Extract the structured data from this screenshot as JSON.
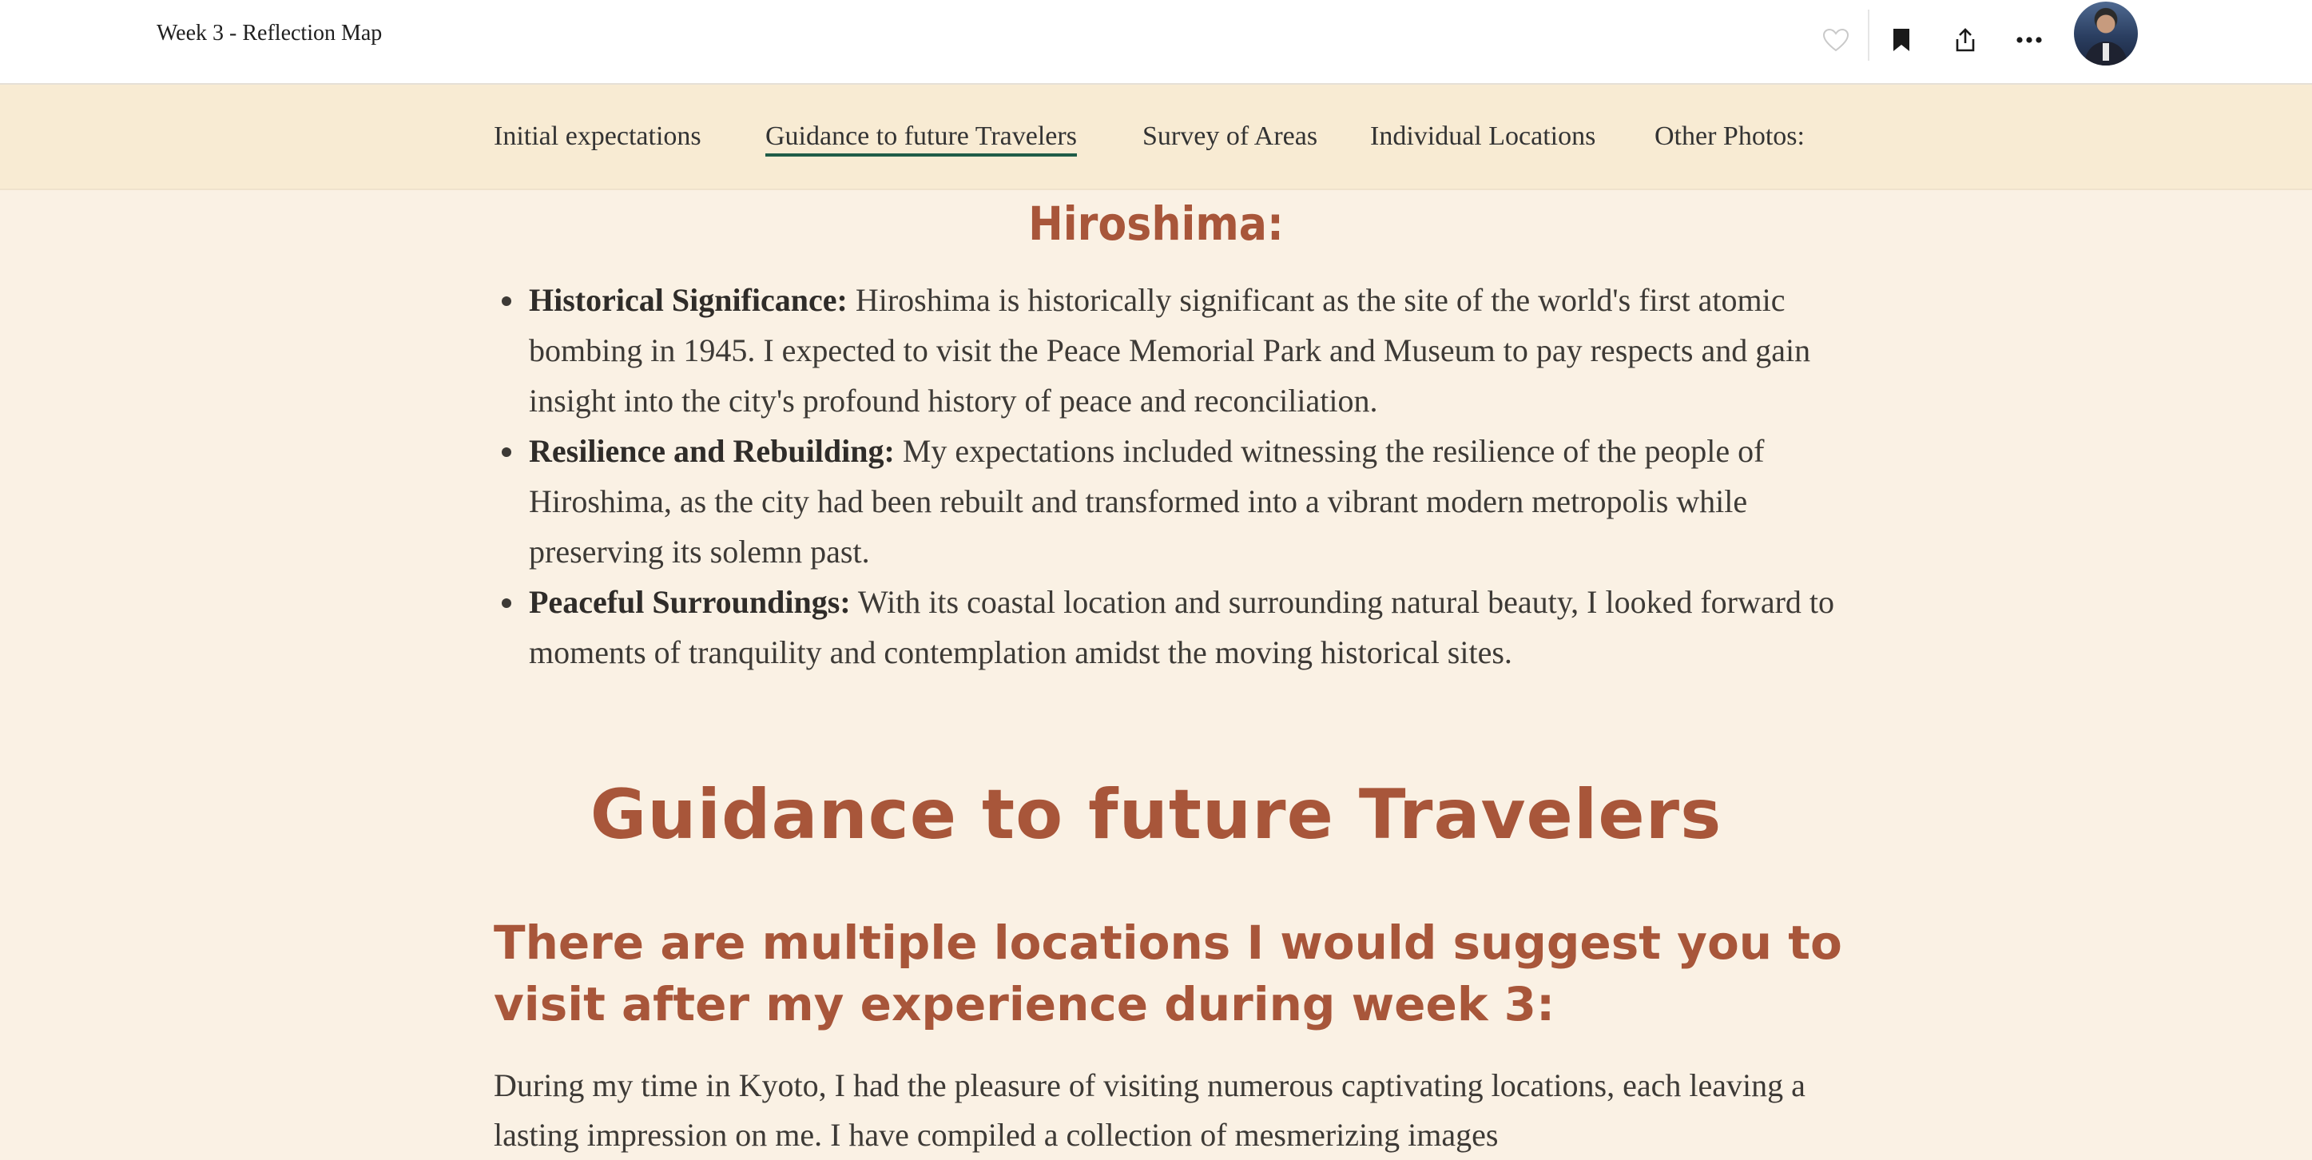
{
  "header": {
    "title": "Week 3 - Reflection Map",
    "actions": {
      "heart": "heart-icon",
      "bookmark": "bookmark-icon",
      "share": "share-icon",
      "more": "more-icon"
    }
  },
  "nav": {
    "items": [
      {
        "label": "Initial expectations"
      },
      {
        "label": "Guidance to future Travelers"
      },
      {
        "label": "Survey of Areas"
      },
      {
        "label": "Individual Locations"
      },
      {
        "label": "Other Photos:"
      }
    ],
    "active_index": 1
  },
  "hiroshima": {
    "heading": "Hiroshima:",
    "bullets": [
      {
        "term": "Historical Significance:",
        "text": " Hiroshima is historically significant as the site of the world's first atomic bombing in 1945. I expected to visit the Peace Memorial Park and Museum to pay respects and gain insight into the city's profound history of peace and reconciliation."
      },
      {
        "term": "Resilience and Rebuilding:",
        "text": " My expectations included witnessing the resilience of the people of Hiroshima, as the city had been rebuilt and transformed into a vibrant modern metropolis while preserving its solemn past."
      },
      {
        "term": "Peaceful Surroundings:",
        "text": " With its coastal location and surrounding natural beauty, I looked forward to moments of tranquility and contemplation amidst the moving historical sites."
      }
    ]
  },
  "guidance": {
    "heading": "Guidance to future Travelers",
    "subheading": "There are multiple locations I would suggest you to visit after my experience during week 3:",
    "paragraph": "During my time in Kyoto, I had the pleasure of visiting numerous captivating locations, each leaving a lasting impression on me. I have compiled a collection of mesmerizing images"
  },
  "colors": {
    "accent": "#a8563a",
    "nav_underline": "#1f5c48",
    "page_bg": "#faf1e4",
    "nav_bg": "#f8ebd3"
  }
}
